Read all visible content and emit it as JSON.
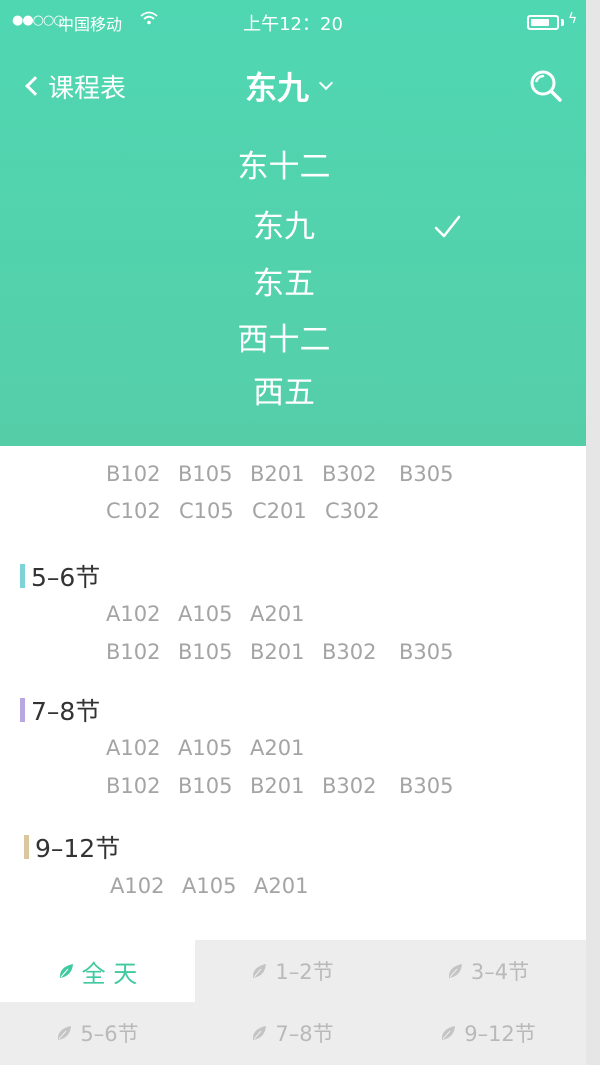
{
  "status_bar": {
    "carrier": "中国移动",
    "time": "上午12：20",
    "battery_level": 0.75
  },
  "nav": {
    "back_label": "课程表",
    "title": "东九"
  },
  "dropdown": {
    "items": [
      "东十二",
      "东九",
      "东五",
      "西十二",
      "西五"
    ],
    "selected": "东九"
  },
  "schedule": {
    "top_rows": [
      [
        "B102",
        "B105",
        "B201",
        "B302",
        "B305"
      ],
      [
        "C102",
        "C105",
        "C201",
        "C302"
      ]
    ],
    "sections": [
      {
        "title": "5–6节",
        "rows": [
          [
            "A102",
            "A105",
            "A201"
          ],
          [
            "B102",
            "B105",
            "B201",
            "B302",
            "B305"
          ]
        ]
      },
      {
        "title": "7–8节",
        "rows": [
          [
            "A102",
            "A105",
            "A201"
          ],
          [
            "B102",
            "B105",
            "B201",
            "B302",
            "B305"
          ]
        ]
      },
      {
        "title": "9–12节",
        "rows": [
          [
            "A102",
            "A105",
            "A201"
          ]
        ]
      }
    ]
  },
  "tabs": [
    {
      "label": "全 天",
      "active": true
    },
    {
      "label": "1–2节",
      "active": false
    },
    {
      "label": "3–4节",
      "active": false
    },
    {
      "label": "5–6节",
      "active": false
    },
    {
      "label": "7–8节",
      "active": false
    },
    {
      "label": "9–12节",
      "active": false
    }
  ],
  "colors": {
    "header_top": "#4fd7b2",
    "header_bottom": "#55cea8",
    "accent": "#41c9a0",
    "section_5_6": "#7fd3d6",
    "section_7_8": "#b9a8e0",
    "section_9_12": "#d9c79e"
  }
}
